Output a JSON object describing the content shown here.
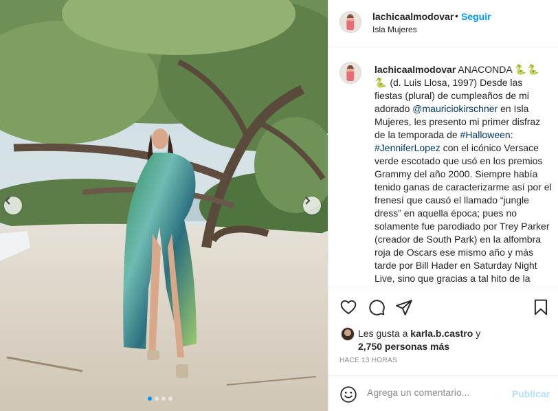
{
  "post": {
    "username": "lachicaalmodovar",
    "bullet": "•",
    "follow_label": "Seguir",
    "location": "Isla Mujeres"
  },
  "caption": {
    "username": "lachicaalmodovar",
    "part1": " ANACONDA ",
    "emoji": "🐍🐍🐍",
    "part2": " (d. Luis Llosa, 1997) Desde las fiestas (plural) de cumpleaños de mi adorado ",
    "mention": "@mauriciokirschner",
    "part3": " en Isla Mujeres, les presento mi primer disfraz de la temporada de ",
    "hashtag1": "#Halloween",
    "part4": ": ",
    "hashtag2": "#JenniferLopez",
    "part5": " con el icónico Versace verde escotado que usó en los premios Grammy del año 2000. Siempre había tenido ganas de caracterizarme así por el frenesí que causó el llamado “jungle dress” en aquella época; pues no solamente fue parodiado por Trey Parker (creador de South Park) en la alfombra roja de Oscars ese mismo año y más tarde por Bill Hader en Saturday Night Live, sino que gracias a tal hito de la cultura pop es que surgió la idea de"
  },
  "likes": {
    "prefix": "Les gusta a ",
    "user": "karla.b.castro",
    "middle": " y ",
    "count": "2,750 personas más"
  },
  "timestamp": "HACE 13 HORAS",
  "comment": {
    "placeholder": "Agrega un comentario...",
    "publish_label": "Publicar"
  },
  "carousel": {
    "slides": 4,
    "active_index": 0
  },
  "icons": [
    "chevron-left-icon",
    "chevron-right-icon",
    "heart-icon",
    "comment-icon",
    "share-icon",
    "bookmark-icon",
    "smiley-icon"
  ],
  "colors": {
    "accent": "#0095f6",
    "link": "#00376b",
    "muted": "#8e8e8e",
    "publish_disabled": "#b2dffc"
  }
}
